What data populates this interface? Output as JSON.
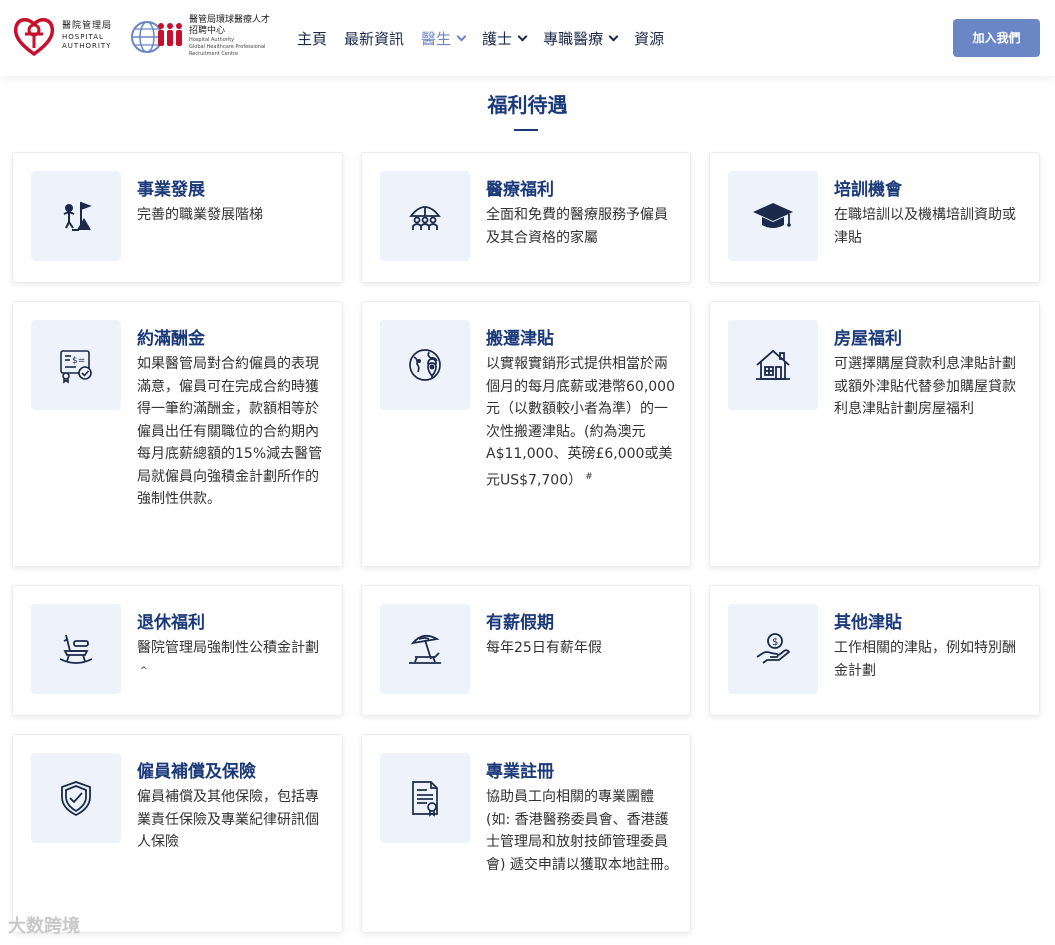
{
  "header": {
    "logo_ha": {
      "zh": "醫院管理局",
      "en1": "HOSPITAL",
      "en2": "AUTHORITY"
    },
    "logo_rc": {
      "zh1": "醫管局環球醫療人才",
      "zh2": "招聘中心",
      "en1": "Hospital Authority",
      "en2": "Global Healthcare Professional",
      "en3": "Recruitment Centre"
    },
    "nav": [
      {
        "label": "主頁",
        "dropdown": false,
        "active": false
      },
      {
        "label": "最新資訊",
        "dropdown": false,
        "active": false
      },
      {
        "label": "醫生",
        "dropdown": true,
        "active": true
      },
      {
        "label": "護士",
        "dropdown": true,
        "active": false
      },
      {
        "label": "專職醫療",
        "dropdown": true,
        "active": false
      },
      {
        "label": "資源",
        "dropdown": false,
        "active": false
      }
    ],
    "join_button": "加入我們"
  },
  "section": {
    "title": "福利待遇"
  },
  "cards": [
    {
      "title": "事業發展",
      "text": "完善的職業發展階梯",
      "icon": "career-flag-icon"
    },
    {
      "title": "醫療福利",
      "text": "全面和免費的醫療服務予僱員及其合資格的家屬",
      "icon": "family-umbrella-icon"
    },
    {
      "title": "培訓機會",
      "text": "在職培訓以及機構培訓資助或津貼",
      "icon": "graduation-cap-icon"
    },
    {
      "title": "約滿酬金",
      "text": "如果醫管局對合約僱員的表現滿意，僱員可在完成合約時獲得一筆約滿酬金，款額相等於僱員出任有關職位的合約期內每月底薪總額的15%減去醫管局就僱員向強積金計劃所作的強制性供款。",
      "icon": "certificate-icon"
    },
    {
      "title": "搬遷津貼",
      "text": "以實報實銷形式提供相當於兩個月的每月底薪或港幣60,000元（以數額較小者為準）的一次性搬遷津貼。(約為澳元A$11,000、英磅£6,000或美元US$7,700）",
      "sup": "#",
      "icon": "globe-location-icon"
    },
    {
      "title": "房屋福利",
      "text": "可選擇購屋貸款利息津貼計劃或額外津貼代替參加購屋貸款利息津貼計劃房屋福利",
      "icon": "house-icon"
    },
    {
      "title": "退休福利",
      "text": "醫院管理局強制性公積金計劃",
      "sup": "^",
      "icon": "rocking-chair-icon"
    },
    {
      "title": "有薪假期",
      "text": "每年25日有薪年假",
      "icon": "beach-umbrella-icon"
    },
    {
      "title": "其他津貼",
      "text": "工作相關的津貼，例如特別酬金計劃",
      "icon": "hand-coin-icon"
    },
    {
      "title": "僱員補償及保險",
      "text": "僱員補償及其他保險，包括專業責任保險及專業紀律研訊個人保險",
      "icon": "shield-check-icon"
    },
    {
      "title": "專業註冊",
      "text": "協助員工向相關的專業團體 (如: 香港醫務委員會、香港護士管理局和放射技師管理委員會) 遞交申請以獲取本地註冊。",
      "icon": "registration-document-icon"
    }
  ],
  "watermark": "大数跨境",
  "colors": {
    "primary": "#1b3a7a",
    "accent": "#6b86c4",
    "icon_bg": "#eef3fb",
    "logo_red": "#c8102e"
  }
}
